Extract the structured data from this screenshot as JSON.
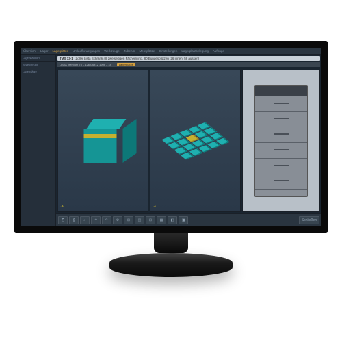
{
  "menu": [
    "Übersicht",
    "Lager",
    "Lagerplätze",
    "Umlaufbewegungen",
    "Werkzeuge",
    "Zubehör",
    "Messplätze",
    "Einstellungen",
    "Lagerplatzbelegung",
    "Aufträge"
  ],
  "sidebar": {
    "items": [
      "Lagerstandort",
      "Bezeichnung",
      "Lagerplätze"
    ]
  },
  "infobar": {
    "code": "TMS 13-1",
    "description": "Zoller Lista Schrank 48 zweiseitigen Fächern incl. 80 Bundespfützen [26 innen, 58 aussen]"
  },
  "infobar2": {
    "title": "LISTA premium 75 – 126x36x12 1008 – 18",
    "tag": "Lagerplätze"
  },
  "cabinet": {
    "drawers": 6,
    "highlight_row": 1
  },
  "grid": {
    "cols": 5,
    "rows": 4,
    "highlight": 7
  },
  "toolbar": {
    "btns": [
      "⎘",
      "⎙",
      "⌂",
      "↶",
      "↷",
      "⚙",
      "⊞",
      "◫",
      "⊡",
      "▦",
      "◧",
      "◨"
    ],
    "close": "Schließen"
  }
}
